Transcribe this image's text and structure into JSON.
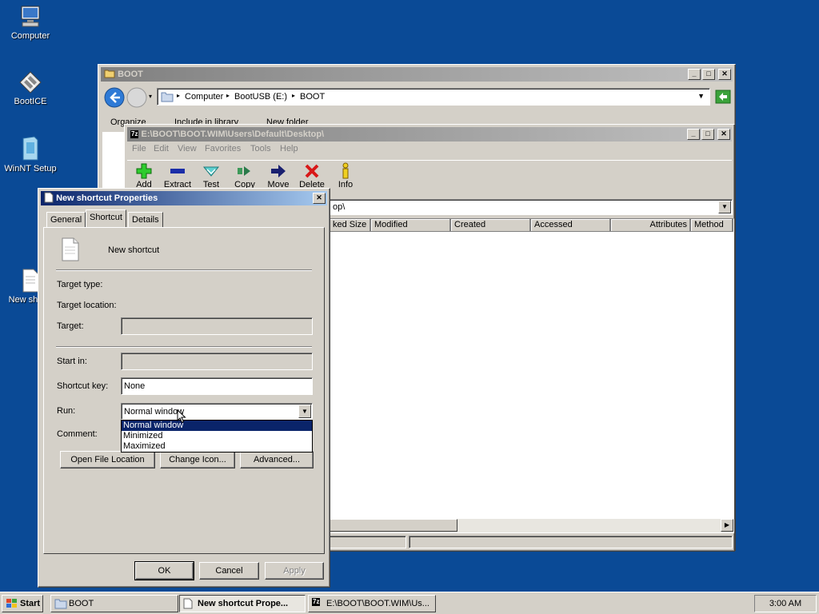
{
  "desktop": {
    "icons": [
      {
        "label": "Computer"
      },
      {
        "label": "BootICE"
      },
      {
        "label": "WinNT Setup"
      },
      {
        "label": "New sho"
      }
    ]
  },
  "explorer": {
    "title": "BOOT",
    "path": [
      "Computer",
      "BootUSB (E:)",
      "BOOT"
    ],
    "toolbar": [
      "Organize",
      "Include in library",
      "New folder"
    ]
  },
  "sevenzip": {
    "title": "E:\\BOOT\\BOOT.WIM\\Users\\Default\\Desktop\\",
    "menu": [
      "File",
      "Edit",
      "View",
      "Favorites",
      "Tools",
      "Help"
    ],
    "tools": [
      "Add",
      "Extract",
      "Test",
      "Copy",
      "Move",
      "Delete",
      "Info"
    ],
    "address": "op\\",
    "columns": [
      "ked Size",
      "Modified",
      "Created",
      "Accessed",
      "Attributes",
      "Method"
    ]
  },
  "dialog": {
    "title": "New shortcut Properties",
    "tabs": [
      "General",
      "Shortcut",
      "Details"
    ],
    "name": "New shortcut",
    "labels": {
      "target_type": "Target type:",
      "target_location": "Target location:",
      "target": "Target:",
      "start_in": "Start in:",
      "shortcut_key": "Shortcut key:",
      "run": "Run:",
      "comment": "Comment:"
    },
    "shortcut_key_value": "None",
    "run_value": "Normal window",
    "run_options": [
      "Normal window",
      "Minimized",
      "Maximized"
    ],
    "buttons": {
      "open_location": "Open File Location",
      "change_icon": "Change Icon...",
      "advanced": "Advanced...",
      "ok": "OK",
      "cancel": "Cancel",
      "apply": "Apply"
    }
  },
  "taskbar": {
    "start": "Start",
    "items": [
      "BOOT",
      "New shortcut Prope...",
      "E:\\BOOT\\BOOT.WIM\\Us..."
    ],
    "clock": "3:00 AM"
  }
}
